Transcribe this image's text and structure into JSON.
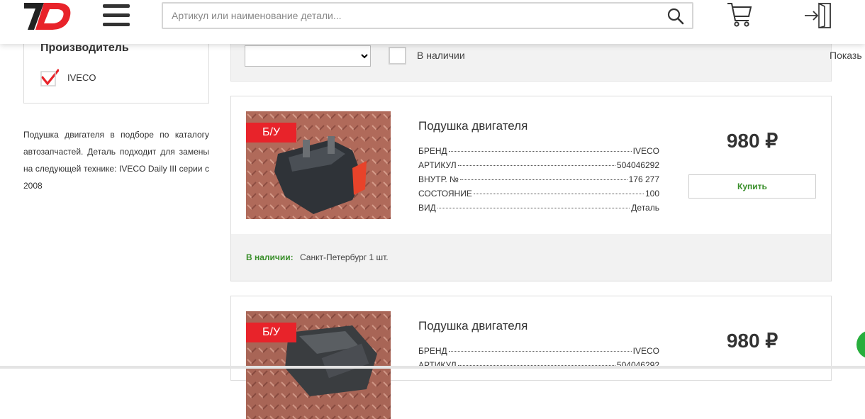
{
  "header": {
    "logo_text": "7D",
    "search_placeholder": "Артикул или наименование детали...",
    "icons": [
      "menu-icon",
      "search-icon",
      "cart-icon",
      "login-icon"
    ]
  },
  "sidebar": {
    "filter_title": "Производитель",
    "filter_items": [
      {
        "label": "IVECO",
        "checked": true
      }
    ],
    "description": "Подушка двигателя в подборе по каталогу автозапчастей. Деталь подходит для замены на следующей технике: IVECO Daily III серии с 2008"
  },
  "toolbar": {
    "sort_value": "",
    "in_stock_label": "В наличии",
    "show_label": "Показь"
  },
  "products": [
    {
      "badge": "Б/У",
      "title": "Подушка двигателя",
      "specs": [
        {
          "key": "БРЕНД",
          "value": "IVECO"
        },
        {
          "key": "АРТИКУЛ",
          "value": "504046292"
        },
        {
          "key": "ВНУТР. №",
          "value": "176 277"
        },
        {
          "key": "СОСТОЯНИЕ",
          "value": "100"
        },
        {
          "key": "ВИД",
          "value": "Деталь"
        }
      ],
      "price": "980 ₽",
      "buy_label": "Купить",
      "stock_title": "В наличии:",
      "stock_info": "Санкт-Петербург  1 шт."
    },
    {
      "badge": "Б/У",
      "title": "Подушка двигателя",
      "specs": [
        {
          "key": "БРЕНД",
          "value": "IVECO"
        },
        {
          "key": "АРТИКУЛ",
          "value": "504046292"
        }
      ],
      "price": "980 ₽"
    }
  ],
  "colors": {
    "accent_red": "#e8232a",
    "stock_green": "#3a8f2b",
    "chat_green": "#27ae3c"
  }
}
